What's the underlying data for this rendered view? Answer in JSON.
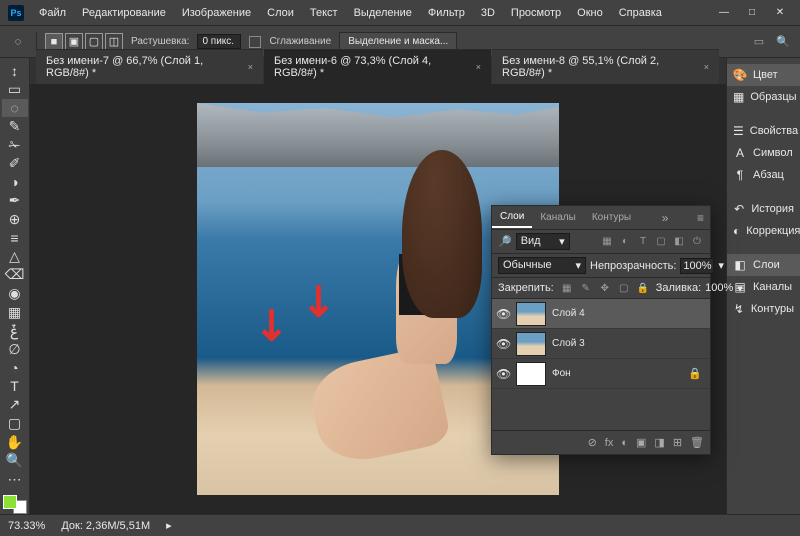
{
  "app": {
    "logo": "Ps"
  },
  "menu": [
    "Файл",
    "Редактирование",
    "Изображение",
    "Слои",
    "Текст",
    "Выделение",
    "Фильтр",
    "3D",
    "Просмотр",
    "Окно",
    "Справка"
  ],
  "winbtns": {
    "min": "—",
    "max": "□",
    "close": "✕"
  },
  "options": {
    "feather_label": "Растушевка:",
    "feather_value": "0 пикс.",
    "antialias": "Сглаживание",
    "select_mask": "Выделение и маска..."
  },
  "tools": [
    "↕",
    "▭",
    "◌",
    "✎",
    "✁",
    "✐",
    "◑",
    "✒",
    "⊕",
    "≡",
    "△",
    "⌫",
    "◉",
    "▦",
    "ݞ",
    "∅",
    "◔",
    "T",
    "↗",
    "▢",
    "✋",
    "🔍",
    "⋯"
  ],
  "tabs": [
    {
      "label": "Без имени-7 @ 66,7% (Слой 1, RGB/8#) *",
      "active": false
    },
    {
      "label": "Без имени-6 @ 73,3% (Слой 4, RGB/8#) *",
      "active": true
    },
    {
      "label": "Без имени-8 @ 55,1% (Слой 2, RGB/8#) *",
      "active": false
    }
  ],
  "right_panels": [
    {
      "icon": "🎨",
      "label": "Цвет",
      "active": true
    },
    {
      "icon": "▦",
      "label": "Образцы"
    },
    {
      "sep": true
    },
    {
      "icon": "☰",
      "label": "Свойства"
    },
    {
      "icon": "A",
      "label": "Символ"
    },
    {
      "icon": "¶",
      "label": "Абзац"
    },
    {
      "sep": true
    },
    {
      "icon": "↶",
      "label": "История"
    },
    {
      "icon": "◐",
      "label": "Коррекция"
    },
    {
      "sep": true
    },
    {
      "icon": "◧",
      "label": "Слои",
      "active": true
    },
    {
      "icon": "▤",
      "label": "Каналы"
    },
    {
      "icon": "↯",
      "label": "Контуры"
    }
  ],
  "layers_panel": {
    "tabs": [
      "Слои",
      "Каналы",
      "Контуры"
    ],
    "search_icon": "🔎",
    "search_type": "Вид",
    "blend_mode": "Обычные",
    "opacity_label": "Непрозрачность:",
    "opacity": "100%",
    "lock_label": "Закрепить:",
    "fill_label": "Заливка:",
    "fill": "100%",
    "layers": [
      {
        "name": "Слой 4",
        "selected": true,
        "thumb": "img"
      },
      {
        "name": "Слой 3",
        "thumb": "img"
      },
      {
        "name": "Фон",
        "thumb": "white",
        "locked": true
      }
    ],
    "footer_icons": [
      "⊘",
      "fx",
      "◐",
      "▣",
      "◨",
      "⊞",
      "🗑"
    ]
  },
  "status": {
    "zoom": "73.33%",
    "doc": "Док: 2,36M/5,51M"
  }
}
